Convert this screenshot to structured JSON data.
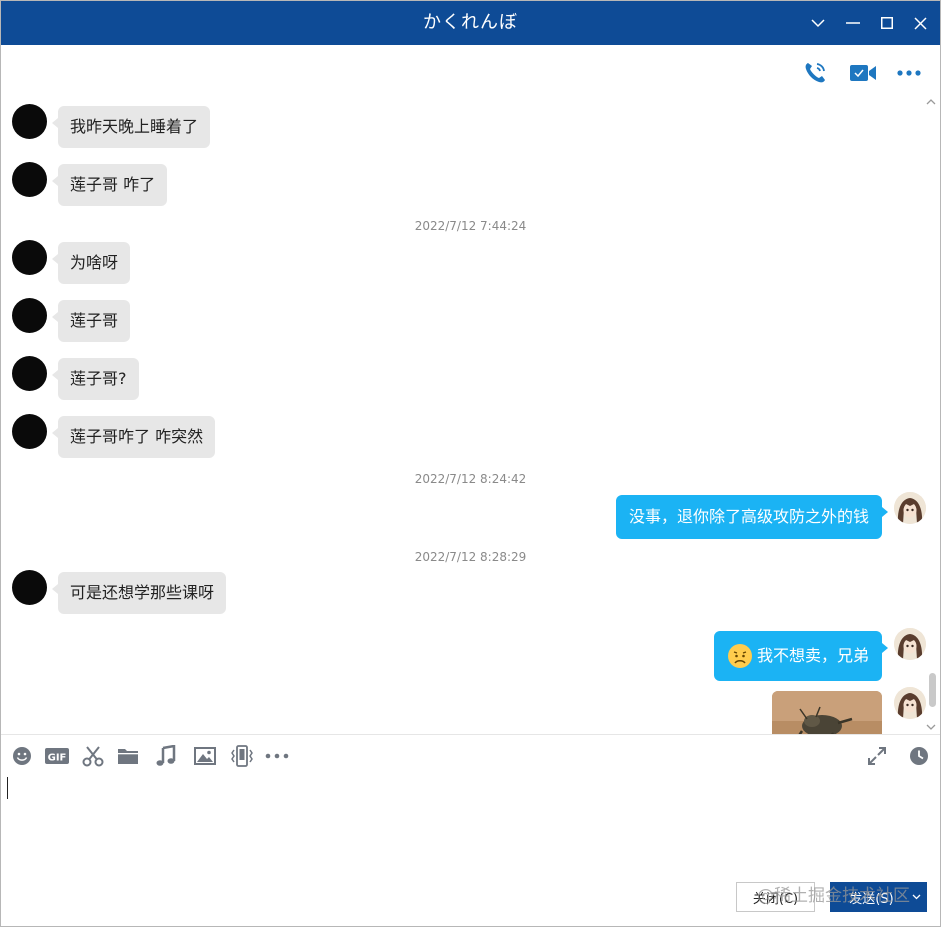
{
  "window": {
    "title": "かくれんぼ",
    "accent": "#0e4b96",
    "controls": [
      "chevron-down-icon",
      "minimize-icon",
      "maximize-icon",
      "close-icon"
    ]
  },
  "header_actions": [
    "phone-call-icon",
    "video-call-icon",
    "more-icon"
  ],
  "messages": [
    {
      "side": "left",
      "text": "我昨天晚上睡着了"
    },
    {
      "side": "left",
      "text": "莲子哥 咋了"
    },
    {
      "type": "time",
      "text": "2022/7/12 7:44:24"
    },
    {
      "side": "left",
      "text": "为啥呀"
    },
    {
      "side": "left",
      "text": "莲子哥"
    },
    {
      "side": "left",
      "text": "莲子哥?"
    },
    {
      "side": "left",
      "text": "莲子哥咋了 咋突然"
    },
    {
      "type": "time",
      "text": "2022/7/12 8:24:42"
    },
    {
      "side": "right",
      "text": "没事，退你除了高级攻防之外的钱"
    },
    {
      "type": "time",
      "text": "2022/7/12 8:28:29"
    },
    {
      "side": "left",
      "text": "可是还想学那些课呀"
    },
    {
      "side": "right",
      "emoji": "worried-face",
      "text": "我不想卖，兄弟"
    },
    {
      "side": "right",
      "type": "image",
      "description": "insect-photo"
    }
  ],
  "colors": {
    "bubble_left": "#e7e7e7",
    "bubble_right": "#1bb3f4",
    "timestamp": "#8a8a8a"
  },
  "input_toolbar": [
    "emoji-icon",
    "gif-icon",
    "scissors-icon",
    "folder-icon",
    "music-icon",
    "image-icon",
    "shake-icon",
    "more-icon",
    "expand-icon",
    "history-icon"
  ],
  "input": {
    "value": ""
  },
  "buttons": {
    "close": "关闭(C)",
    "send": "发送(S)"
  },
  "watermark": "@稀土掘金技术社区"
}
